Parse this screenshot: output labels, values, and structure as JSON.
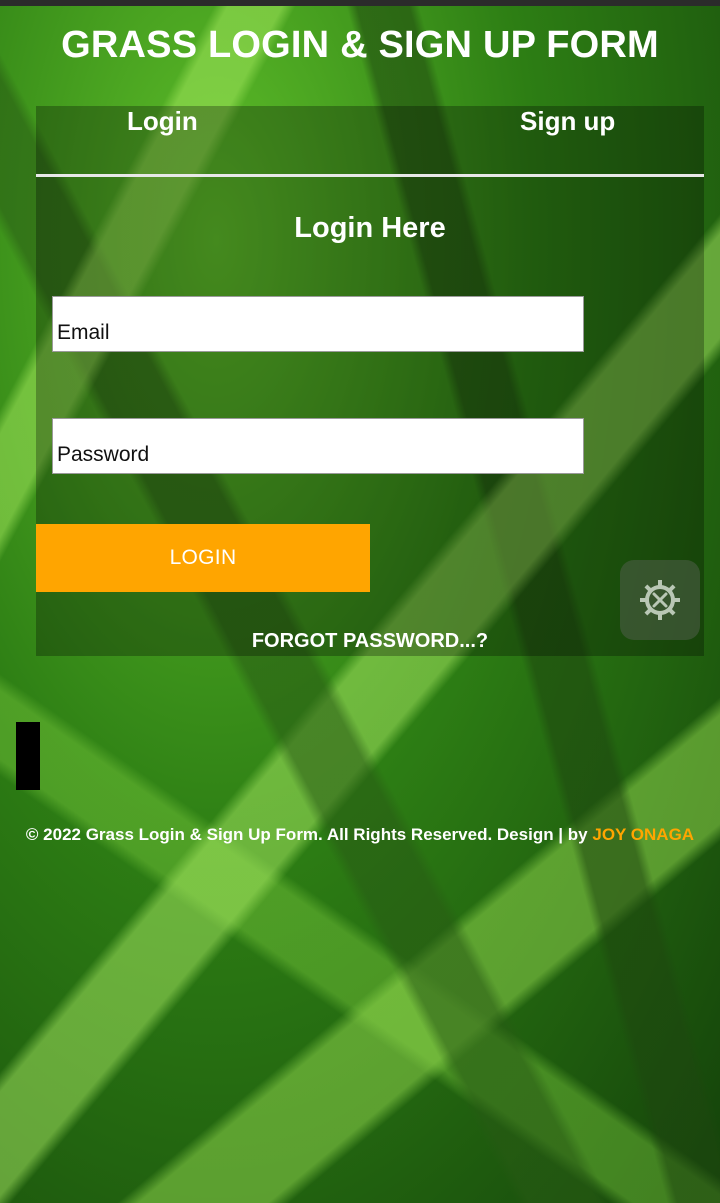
{
  "header": {
    "title": "GRASS LOGIN & SIGN UP FORM"
  },
  "tabs": {
    "login_label": "Login",
    "signup_label": "Sign up"
  },
  "form": {
    "heading": "Login Here",
    "email_placeholder": "Email",
    "password_placeholder": "Password",
    "submit_label": "LOGIN",
    "forgot_label": "FORGOT PASSWORD...?"
  },
  "floating": {
    "settings_icon": "settings-tools-icon"
  },
  "footer": {
    "copyright_text": "© 2022 Grass Login & Sign Up Form. All Rights Reserved. Design | by ",
    "author": "JOY ONAGA"
  },
  "colors": {
    "accent": "#ffa500",
    "text": "#ffffff",
    "field_bg": "#ffffff"
  }
}
